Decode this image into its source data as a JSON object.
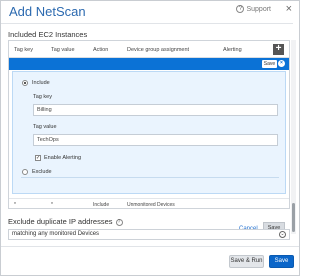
{
  "dialog": {
    "title": "Add NetScan",
    "support_label": "Support",
    "close_glyph": "×"
  },
  "section": {
    "label": "Included EC2 Instances"
  },
  "table": {
    "headers": [
      "Tag key",
      "Tag value",
      "Action",
      "Device group assignment",
      "Alerting"
    ],
    "add_glyph": "+",
    "band_save_label": "Save",
    "band_close_glyph": "×",
    "row": {
      "tag_key": "*",
      "tag_value": "*",
      "action": "Include",
      "group": "Unmonitored Devices"
    }
  },
  "editor": {
    "include_label": "Include",
    "tag_key_label": "Tag key",
    "tag_key_value": "Billing",
    "tag_value_label": "Tag value",
    "tag_value_value": "TechOps",
    "enable_alerting_label": "Enable Alerting",
    "enable_alerting_checked": true,
    "exclude_label": "Exclude",
    "cancel_label": "Cancel",
    "save_label": "Save",
    "selected_action": "include"
  },
  "duplicates": {
    "label": "Exclude duplicate IP addresses",
    "help_glyph": "?",
    "selected": "matching any monitored Devices"
  },
  "footer": {
    "save_run_label": "Save & Run",
    "save_label": "Save"
  },
  "colors": {
    "accent": "#0b72d6",
    "title": "#2c6ab0",
    "editor_bg": "#eaf4fe"
  }
}
